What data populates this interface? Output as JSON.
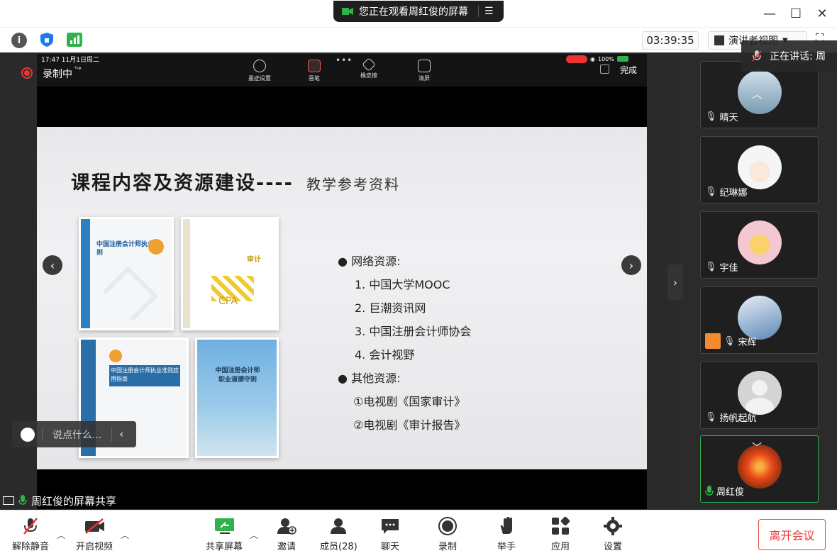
{
  "titlebar": {
    "banner_text": "您正在观看周红俊的屏幕"
  },
  "infobar": {
    "timer": "03:39:35",
    "view_mode": "演讲者视图",
    "speaking": "正在讲话: 周"
  },
  "recording": {
    "label": "录制中",
    "phone_time": "17:47  11月1日周二",
    "battery": "100%"
  },
  "annotation_tools": [
    "墨迹设置",
    "画笔",
    "橡皮擦",
    "清屏"
  ],
  "annotation_done": "完成",
  "slide": {
    "title": "课程内容及资源建设----",
    "subtitle": "教学参考资料",
    "bullets": [
      {
        "bullet": "●",
        "text": "网络资源:"
      },
      {
        "bullet": "1.",
        "text": "中国大学MOOC"
      },
      {
        "bullet": "2.",
        "text": "巨潮资讯网"
      },
      {
        "bullet": "3.",
        "text": "中国注册会计师协会"
      },
      {
        "bullet": "4.",
        "text": "会计视野"
      },
      {
        "bullet": "●",
        "text": "其他资源:"
      },
      {
        "bullet": "①",
        "text": "电视剧《国家审计》"
      },
      {
        "bullet": "②",
        "text": "电视剧《审计报告》"
      }
    ],
    "books": [
      {
        "title": "中国注册会计师执业准则"
      },
      {
        "title": "审计",
        "badge": "CPA"
      },
      {
        "title": "中国注册会计师执业准则应用指南"
      },
      {
        "title": "中国注册会计师职业道德守则"
      }
    ]
  },
  "chat": {
    "placeholder": "说点什么..."
  },
  "share_label": "周红俊的屏幕共享",
  "participants": [
    {
      "name": "晴天"
    },
    {
      "name": "纪琳娜"
    },
    {
      "name": "宇佳"
    },
    {
      "name": "宋辉"
    },
    {
      "name": "扬帆起航"
    },
    {
      "name": "周红俊"
    }
  ],
  "toolbar": {
    "unmute": "解除静音",
    "video": "开启视频",
    "share": "共享屏幕",
    "invite": "邀请",
    "members": "成员(28)",
    "chat": "聊天",
    "record": "录制",
    "raise_hand": "举手",
    "apps": "应用",
    "settings": "设置",
    "leave": "离开会议"
  },
  "colors": {
    "accent_green": "#2fb24c",
    "danger": "#e33333",
    "dark_bg": "#2b2b2b"
  }
}
